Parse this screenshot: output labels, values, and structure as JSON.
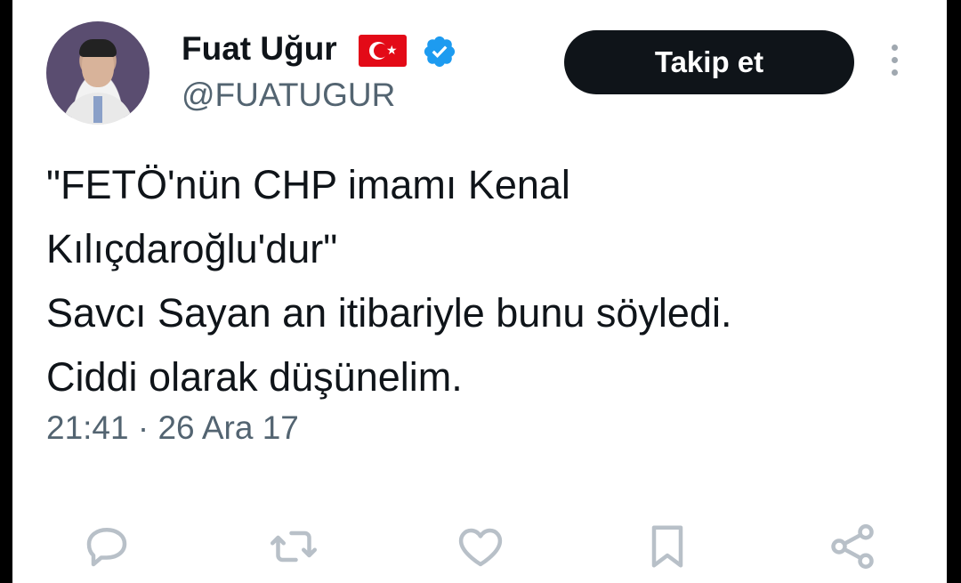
{
  "tweet": {
    "author_name": "Fuat Uğur",
    "handle": "@FUATUGUR",
    "follow_label": "Takip et",
    "text_lines": [
      "\"FETÖ'nün CHP imamı Kenal",
      "Kılıçdaroğlu'dur\"",
      "Savcı Sayan an itibariyle bunu söyledi.",
      "Ciddi olarak düşünelim."
    ],
    "timestamp": "21:41 · 26 Ara 17"
  },
  "icons": {
    "flag": "turkey-flag-icon",
    "verified": "verified-badge-icon",
    "more": "more-options-icon",
    "reply": "reply-icon",
    "retweet": "retweet-icon",
    "like": "like-icon",
    "bookmark": "bookmark-icon",
    "share": "share-icon"
  },
  "colors": {
    "text": "#0f1419",
    "secondary": "#536471",
    "verified": "#1d9bf0",
    "icon": "#b8c0c8",
    "flag_red": "#e30a17"
  }
}
